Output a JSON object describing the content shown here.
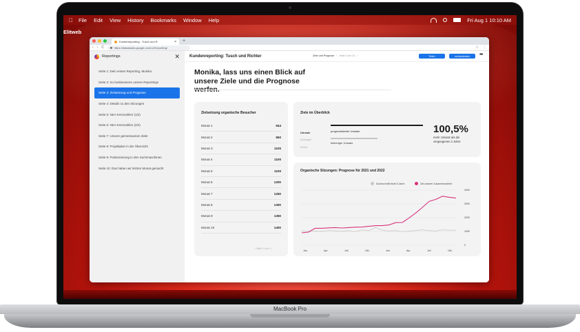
{
  "menubar": {
    "app": "Elitweb",
    "items": [
      "File",
      "Edit",
      "View",
      "History",
      "Bookmarks",
      "Window",
      "Help"
    ],
    "clock": "Fri Aug 1 10:10 AM"
  },
  "browser": {
    "tab_title": "Kundenreporting - Tusch und R",
    "url": "https://datastudio.google.com/u/2/reporting/"
  },
  "sidebar": {
    "title": "Reportings",
    "items": [
      {
        "label": "Seite 1: Dein erstes Reporting, Monika"
      },
      {
        "label": "Seite 2: So funktionieren unsere Reportings"
      },
      {
        "label": "Seite 3: Zielsetzung und Prognose"
      },
      {
        "label": "Seite 4: Details zu den Sitzungen"
      },
      {
        "label": "Seite 5: SEA Kennzahlen (1/2)"
      },
      {
        "label": "Seite 6: SEA Kennzahlen (2/2)"
      },
      {
        "label": "Seite 7: Unsere gemeinsamen Ziele"
      },
      {
        "label": "Seite 8: Projektplan in der Übersicht"
      },
      {
        "label": "Seite 9: Positionierung in den Suchmaschinen"
      },
      {
        "label": "Seite 10: Das haben wir letzten Monat gemacht"
      }
    ],
    "active_index": 2
  },
  "topbar": {
    "title": "Kundenreporting: Tusch und Richter",
    "page_name": "Ziele und Prognose",
    "page_of": "Seite 3 von 10",
    "btn_teilen": "Teilen",
    "btn_zuruck": "zurückstecken"
  },
  "heading": "Monika, lass uns einen Blick auf unsere Ziele und die Prognose werfen.",
  "goal_card": {
    "title": "Zielsetzung organische Besucher",
    "rows": [
      {
        "label": "Monat 1",
        "value": "944"
      },
      {
        "label": "Monat 2",
        "value": "950"
      },
      {
        "label": "Monat 3",
        "value": "1100"
      },
      {
        "label": "Monat 4",
        "value": "1100"
      },
      {
        "label": "Monat 5",
        "value": "1100"
      },
      {
        "label": "Monat 6",
        "value": "1200"
      },
      {
        "label": "Monat 7",
        "value": "1250"
      },
      {
        "label": "Monat 8",
        "value": "1300"
      },
      {
        "label": "Monat 9",
        "value": "1350"
      },
      {
        "label": "Monat 10",
        "value": "1400"
      }
    ],
    "pager": "Seite 1 von 2"
  },
  "overview_card": {
    "title": "Ziele im Überblick",
    "labels": [
      "Umsatz",
      "Anfragen",
      "Klicks"
    ],
    "forecast_label": "prognostizierter Umsatz",
    "previous_label": "bisheriger Umsatz",
    "kpi_value": "100,5%",
    "kpi_sub": "mehr Umsatz als die vergangenen 2 Jahre"
  },
  "chart_data": {
    "type": "line",
    "title": "Organische Sitzungen: Prognose für 2021 und 2022",
    "xlabel": "",
    "ylabel": "",
    "x_tick_labels": [
      "Jan.",
      "Apr.",
      "Juli",
      "Okt.",
      "Jan.",
      "Apr.",
      "Juli",
      "Okt."
    ],
    "y_ticks": [
      0,
      1000,
      2000,
      3000,
      4000
    ],
    "ylim": [
      0,
      4000
    ],
    "grid": true,
    "legend_position": "top-right",
    "series": [
      {
        "name": "Durchschnitt letzte 5 Jahre",
        "color": "#c7c7c7",
        "values": [
          1050,
          1000,
          1030,
          1010,
          1070,
          1040,
          1010,
          1060,
          980,
          1120,
          1060,
          1280,
          1090,
          1030,
          1060,
          980,
          1030,
          1060,
          1120,
          1060,
          1030,
          1120,
          1080,
          1100
        ]
      },
      {
        "name": "Ziel unserer Zusammenarbeit",
        "color": "#d6337a",
        "values": [
          900,
          950,
          1230,
          1230,
          1260,
          1280,
          1250,
          1280,
          1310,
          1320,
          1370,
          1420,
          1420,
          1470,
          1640,
          1650,
          1980,
          2340,
          2750,
          3180,
          3330,
          3560,
          3480,
          3420
        ]
      }
    ]
  },
  "device_label": "MacBook Pro",
  "colors": {
    "accent": "#1a73e8",
    "series_pink": "#d6337a",
    "series_grey": "#c7c7c7"
  }
}
